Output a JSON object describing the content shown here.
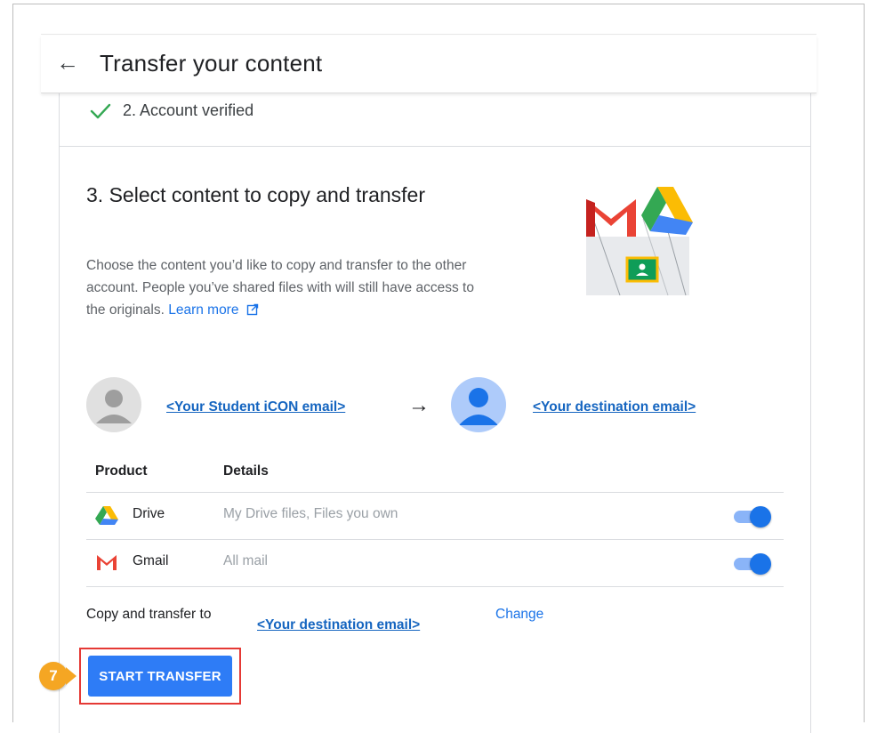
{
  "header": {
    "title": "Transfer your content",
    "back_icon": "arrow-left-icon"
  },
  "step2": {
    "label": "2. Account verified",
    "icon": "check-icon"
  },
  "step3": {
    "title": "3. Select content to copy and transfer",
    "description": "Choose the content you’d like to copy and transfer to the other account. People you’ve shared files with will still have access to the originals.",
    "learn_more": "Learn more"
  },
  "accounts": {
    "source_email": "<Your Student iCON email>",
    "destination_email": "<Your destination email>"
  },
  "table": {
    "headers": {
      "product": "Product",
      "details": "Details"
    },
    "rows": [
      {
        "product": "Drive",
        "details": "My Drive files, Files you own",
        "enabled": true
      },
      {
        "product": "Gmail",
        "details": "All mail",
        "enabled": true
      }
    ]
  },
  "copy_to": {
    "label": "Copy and transfer to",
    "email": "<Your destination email>",
    "change": "Change"
  },
  "start_button": {
    "label": "START TRANSFER"
  },
  "annotation": {
    "step_number": "7",
    "color": "#f5a623",
    "outline_color": "#e53935"
  },
  "colors": {
    "primary": "#1a73e8",
    "button": "#2e7cf6",
    "check": "#34a853",
    "link_email": "#1565c0"
  }
}
